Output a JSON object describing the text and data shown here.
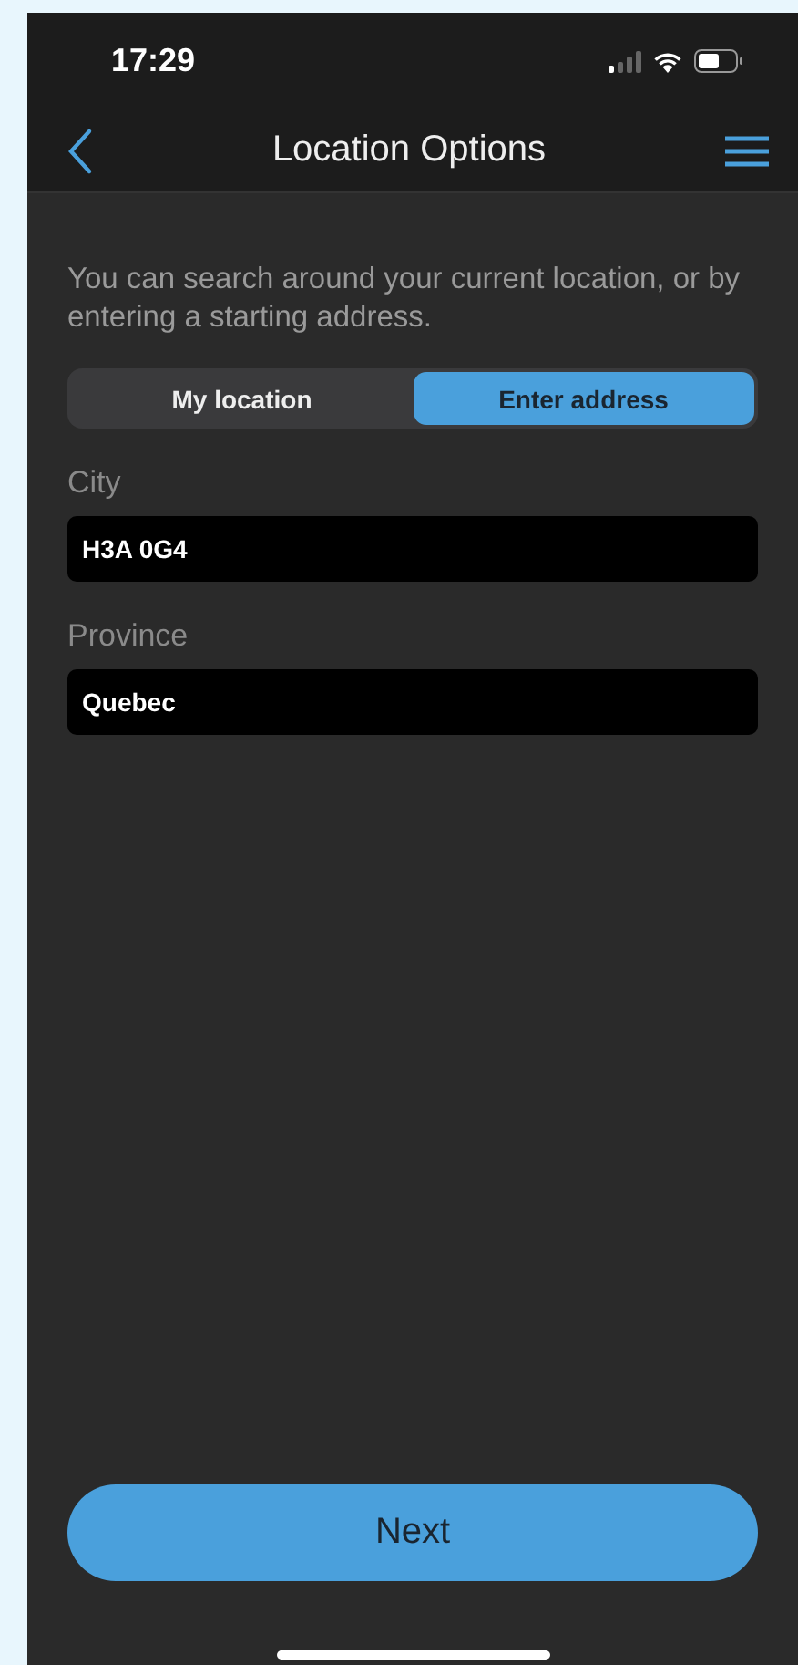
{
  "status_bar": {
    "time": "17:29"
  },
  "nav": {
    "title": "Location Options"
  },
  "intro": "You can search around your current location, or by entering a starting address.",
  "segments": [
    {
      "label": "My location",
      "selected": false
    },
    {
      "label": "Enter address",
      "selected": true
    }
  ],
  "fields": [
    {
      "label": "City",
      "value": "H3A 0G4"
    },
    {
      "label": "Province",
      "value": "Quebec"
    }
  ],
  "next_button": "Next"
}
